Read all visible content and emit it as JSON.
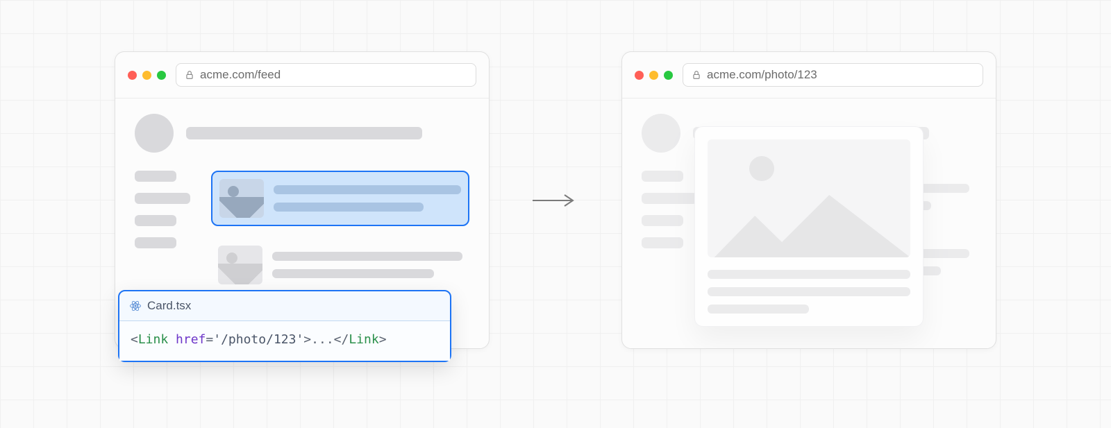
{
  "browser_left": {
    "url": "acme.com/feed"
  },
  "browser_right": {
    "url": "acme.com/photo/123"
  },
  "code_popover": {
    "filename": "Card.tsx",
    "tag": "Link",
    "attr": "href",
    "value": "'/photo/123'",
    "text": "..."
  }
}
